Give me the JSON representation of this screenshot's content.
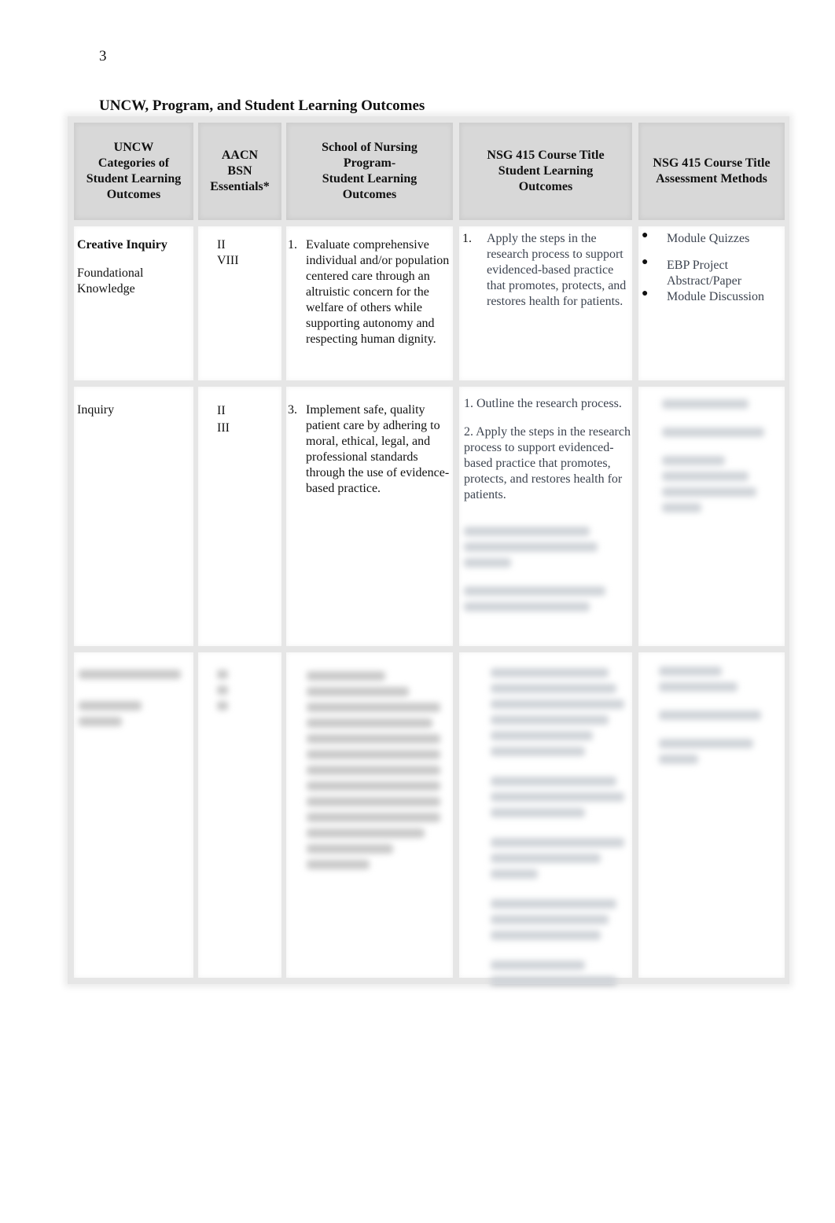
{
  "page_number": "3",
  "title": "UNCW, Program, and Student Learning Outcomes",
  "table": {
    "headers": [
      "UNCW\nCategories of\nStudent Learning\nOutcomes",
      "AACN\nBSN\nEssentials*",
      "School of Nursing\nProgram-\nStudent Learning\nOutcomes",
      "NSG 415  Course Title\nStudent Learning\nOutcomes",
      "NSG 415 Course Title\nAssessment Methods"
    ],
    "rows": [
      {
        "category_primary": "Creative Inquiry",
        "category_secondary": "Foundational\nKnowledge",
        "essentials": "II\nVIII",
        "program_outcome_num": "1.",
        "program_outcome": "Evaluate comprehensive individual and/or population centered care through an altruistic concern for the welfare of others while supporting autonomy and respecting human dignity.",
        "course_outcomes": [
          {
            "num": "1.",
            "text": "Apply the steps in the research process to support evidenced-based practice that promotes, protects, and restores health for patients."
          }
        ],
        "assessments": [
          "Module Quizzes",
          "EBP Project Abstract/Paper",
          "Module Discussion"
        ]
      },
      {
        "category_primary": "Inquiry",
        "essentials": "II\nIII",
        "program_outcome_num": "3.",
        "program_outcome": "Implement safe, quality patient care by adhering to moral, ethical, legal, and professional standards through the use of evidence-based practice.",
        "course_outcomes": [
          {
            "text": "1. Outline the research process."
          },
          {
            "text": "2. Apply the steps in the research process to support evidenced-based practice that promotes, protects, and restores health for patients."
          }
        ],
        "blurred_note": "[additional content obscured]"
      },
      {
        "blurred_note": "[row content obscured]"
      }
    ]
  }
}
